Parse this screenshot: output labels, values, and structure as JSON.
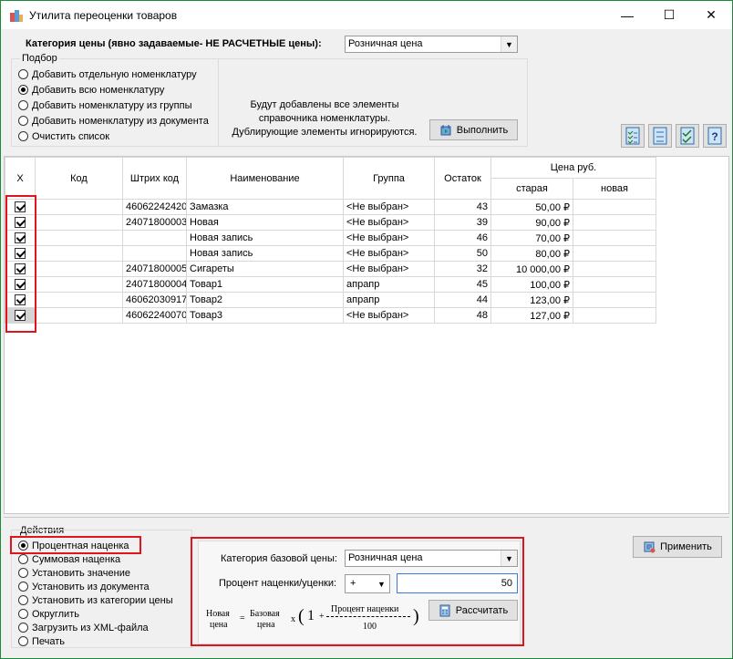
{
  "window": {
    "title": "Утилита переоценки товаров",
    "minimize": "—",
    "maximize": "☐",
    "close": "✕"
  },
  "price_category": {
    "label": "Категория цены (явно задаваемые- НЕ РАСЧЕТНЫЕ цены):",
    "value": "Розничная цена"
  },
  "selection": {
    "title": "Подбор",
    "options": [
      {
        "label": "Добавить отдельную номенклатуру",
        "selected": false
      },
      {
        "label": "Добавить всю номенклатуру",
        "selected": true
      },
      {
        "label": "Добавить номенклатуру из группы",
        "selected": false
      },
      {
        "label": "Добавить номенклатуру из документа",
        "selected": false
      },
      {
        "label": "Очистить список",
        "selected": false
      }
    ],
    "info_line1": "Будут добавлены все элементы",
    "info_line2": "справочника номенклатуры.",
    "info_line3": "Дублирующие элементы игнорируются.",
    "execute_label": "Выполнить"
  },
  "table": {
    "headers": {
      "x": "X",
      "code": "Код",
      "barcode": "Штрих код",
      "name": "Наименование",
      "group": "Группа",
      "stock": "Остаток",
      "price": "Цена руб.",
      "old": "старая",
      "new": "новая"
    },
    "rows": [
      {
        "checked": true,
        "code": "",
        "barcode": "46062242420",
        "name": "Замазка",
        "group": "<Не выбран>",
        "stock": "43",
        "old": "50,00 ₽",
        "new": ""
      },
      {
        "checked": true,
        "code": "",
        "barcode": "24071800003",
        "name": "Новая",
        "group": "<Не выбран>",
        "stock": "39",
        "old": "90,00 ₽",
        "new": ""
      },
      {
        "checked": true,
        "code": "",
        "barcode": "",
        "name": "Новая запись",
        "group": "<Не выбран>",
        "stock": "46",
        "old": "70,00 ₽",
        "new": ""
      },
      {
        "checked": true,
        "code": "",
        "barcode": "",
        "name": "Новая запись",
        "group": "<Не выбран>",
        "stock": "50",
        "old": "80,00 ₽",
        "new": ""
      },
      {
        "checked": true,
        "code": "",
        "barcode": "24071800005",
        "name": "Сигареты",
        "group": "<Не выбран>",
        "stock": "32",
        "old": "10 000,00 ₽",
        "new": ""
      },
      {
        "checked": true,
        "code": "",
        "barcode": "24071800004",
        "name": "Товар1",
        "group": "апрапр",
        "stock": "45",
        "old": "100,00 ₽",
        "new": ""
      },
      {
        "checked": true,
        "code": "",
        "barcode": "46062030917",
        "name": "Товар2",
        "group": "апрапр",
        "stock": "44",
        "old": "123,00 ₽",
        "new": ""
      },
      {
        "checked": true,
        "code": "",
        "barcode": "46062240070",
        "name": "Товар3",
        "group": "<Не выбран>",
        "stock": "48",
        "old": "127,00 ₽",
        "new": ""
      }
    ]
  },
  "actions": {
    "title": "Действия",
    "options": [
      {
        "label": "Процентная наценка",
        "selected": true
      },
      {
        "label": "Суммовая наценка",
        "selected": false
      },
      {
        "label": "Установить значение",
        "selected": false
      },
      {
        "label": "Установить из документа",
        "selected": false
      },
      {
        "label": "Установить из категории цены",
        "selected": false
      },
      {
        "label": "Округлить",
        "selected": false
      },
      {
        "label": "Загрузить из XML-файла",
        "selected": false
      },
      {
        "label": "Печать",
        "selected": false
      }
    ]
  },
  "markup": {
    "base_category_label": "Категория базовой цены:",
    "base_category_value": "Розничная цена",
    "percent_label": "Процент наценки/уценки:",
    "sign_value": "+",
    "percent_value": "50",
    "calculate_label": "Рассчитать",
    "formula": {
      "new1": "Новая",
      "new2": "цена",
      "base1": "Базовая",
      "base2": "цена",
      "x": "x",
      "one": "1",
      "pm": "+",
      "pct": "Процент наценки",
      "hundred": "100"
    }
  },
  "apply_label": "Применить"
}
